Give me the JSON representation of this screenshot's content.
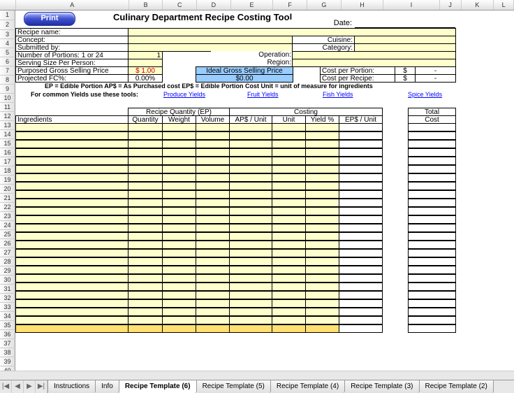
{
  "columns": [
    "A",
    "B",
    "C",
    "D",
    "E",
    "F",
    "G",
    "H",
    "I",
    "J",
    "K",
    "L"
  ],
  "rows_count": 40,
  "print_label": "Print",
  "title": "Culinary Department Recipe Costing Tool",
  "header": {
    "date_label": "Date:",
    "date_value": "",
    "recipe_name_label": "Recipe name:",
    "recipe_name_value": "",
    "concept_label": "Concept:",
    "concept_value": "",
    "cuisine_label": "Cuisine:",
    "cuisine_value": "",
    "submitted_label": "Submitted by:",
    "submitted_value": "",
    "category_label": "Category:",
    "category_value": "",
    "portions_label": "Number of Portions: 1 or 24",
    "portions_value": "1",
    "operation_label": "Operation:",
    "operation_value": "",
    "serving_label": "Serving Size Per Person:",
    "serving_value": "",
    "region_label": "Region:",
    "region_value": "",
    "gross_label": "Purposed Gross Selling Price",
    "gross_value": "$   1.00",
    "ideal_label": "Ideal Gross Selling Price",
    "ideal_value": "$0.00",
    "cost_portion_label": "Cost per Portion:",
    "cost_portion_curr": "$",
    "cost_portion_value": "-",
    "fc_label": "Projected FC%:",
    "fc_value": "0.00%",
    "cost_recipe_label": "Cost per Recipe:",
    "cost_recipe_curr": "$",
    "cost_recipe_value": "-"
  },
  "legend": "EP = Edible Portion    AP$ = As Purchased cost   EP$ = Edible Portion Cost    Unit = unit of measure for ingredients",
  "yields": {
    "intro": "For common Yields use these tools:",
    "links": [
      "Produce Yields",
      "Fruit Yields",
      "Fish Yields",
      "Spice Yields"
    ]
  },
  "table": {
    "group_recipe_qty": "Recipe Quantity (EP)",
    "group_costing": "Costing",
    "group_total": "Total",
    "ingredients": "Ingredients",
    "quantity": "Quantity",
    "weight": "Weight",
    "volume": "Volume",
    "ap_unit": "AP$ / Unit",
    "unit": "Unit",
    "yield": "Yield %",
    "ep_unit": "EP$ / Unit",
    "cost": "Cost"
  },
  "tabs": {
    "nav": [
      "|◀",
      "◀",
      "▶",
      "▶|"
    ],
    "list": [
      "Instructions",
      "Info",
      "Recipe Template (6)",
      "Recipe Template (5)",
      "Recipe Template (4)",
      "Recipe Template (3)",
      "Recipe Template (2)"
    ],
    "active": 2
  }
}
